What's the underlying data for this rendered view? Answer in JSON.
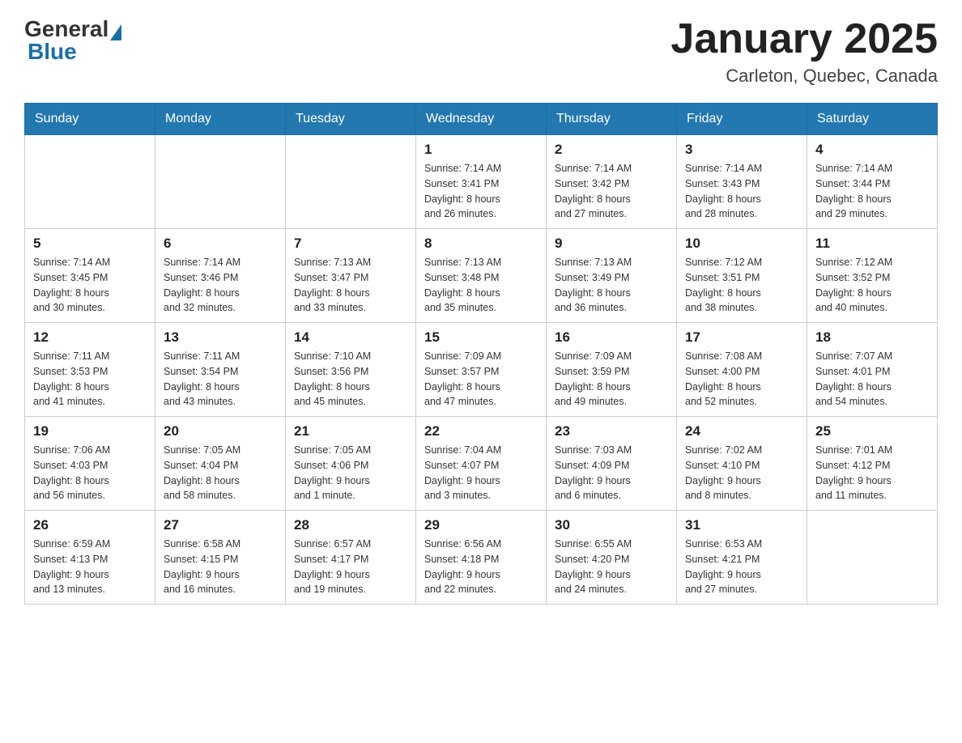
{
  "header": {
    "logo_general": "General",
    "logo_blue": "Blue",
    "month_title": "January 2025",
    "location": "Carleton, Quebec, Canada"
  },
  "days_of_week": [
    "Sunday",
    "Monday",
    "Tuesday",
    "Wednesday",
    "Thursday",
    "Friday",
    "Saturday"
  ],
  "weeks": [
    [
      {
        "day": "",
        "info": ""
      },
      {
        "day": "",
        "info": ""
      },
      {
        "day": "",
        "info": ""
      },
      {
        "day": "1",
        "info": "Sunrise: 7:14 AM\nSunset: 3:41 PM\nDaylight: 8 hours\nand 26 minutes."
      },
      {
        "day": "2",
        "info": "Sunrise: 7:14 AM\nSunset: 3:42 PM\nDaylight: 8 hours\nand 27 minutes."
      },
      {
        "day": "3",
        "info": "Sunrise: 7:14 AM\nSunset: 3:43 PM\nDaylight: 8 hours\nand 28 minutes."
      },
      {
        "day": "4",
        "info": "Sunrise: 7:14 AM\nSunset: 3:44 PM\nDaylight: 8 hours\nand 29 minutes."
      }
    ],
    [
      {
        "day": "5",
        "info": "Sunrise: 7:14 AM\nSunset: 3:45 PM\nDaylight: 8 hours\nand 30 minutes."
      },
      {
        "day": "6",
        "info": "Sunrise: 7:14 AM\nSunset: 3:46 PM\nDaylight: 8 hours\nand 32 minutes."
      },
      {
        "day": "7",
        "info": "Sunrise: 7:13 AM\nSunset: 3:47 PM\nDaylight: 8 hours\nand 33 minutes."
      },
      {
        "day": "8",
        "info": "Sunrise: 7:13 AM\nSunset: 3:48 PM\nDaylight: 8 hours\nand 35 minutes."
      },
      {
        "day": "9",
        "info": "Sunrise: 7:13 AM\nSunset: 3:49 PM\nDaylight: 8 hours\nand 36 minutes."
      },
      {
        "day": "10",
        "info": "Sunrise: 7:12 AM\nSunset: 3:51 PM\nDaylight: 8 hours\nand 38 minutes."
      },
      {
        "day": "11",
        "info": "Sunrise: 7:12 AM\nSunset: 3:52 PM\nDaylight: 8 hours\nand 40 minutes."
      }
    ],
    [
      {
        "day": "12",
        "info": "Sunrise: 7:11 AM\nSunset: 3:53 PM\nDaylight: 8 hours\nand 41 minutes."
      },
      {
        "day": "13",
        "info": "Sunrise: 7:11 AM\nSunset: 3:54 PM\nDaylight: 8 hours\nand 43 minutes."
      },
      {
        "day": "14",
        "info": "Sunrise: 7:10 AM\nSunset: 3:56 PM\nDaylight: 8 hours\nand 45 minutes."
      },
      {
        "day": "15",
        "info": "Sunrise: 7:09 AM\nSunset: 3:57 PM\nDaylight: 8 hours\nand 47 minutes."
      },
      {
        "day": "16",
        "info": "Sunrise: 7:09 AM\nSunset: 3:59 PM\nDaylight: 8 hours\nand 49 minutes."
      },
      {
        "day": "17",
        "info": "Sunrise: 7:08 AM\nSunset: 4:00 PM\nDaylight: 8 hours\nand 52 minutes."
      },
      {
        "day": "18",
        "info": "Sunrise: 7:07 AM\nSunset: 4:01 PM\nDaylight: 8 hours\nand 54 minutes."
      }
    ],
    [
      {
        "day": "19",
        "info": "Sunrise: 7:06 AM\nSunset: 4:03 PM\nDaylight: 8 hours\nand 56 minutes."
      },
      {
        "day": "20",
        "info": "Sunrise: 7:05 AM\nSunset: 4:04 PM\nDaylight: 8 hours\nand 58 minutes."
      },
      {
        "day": "21",
        "info": "Sunrise: 7:05 AM\nSunset: 4:06 PM\nDaylight: 9 hours\nand 1 minute."
      },
      {
        "day": "22",
        "info": "Sunrise: 7:04 AM\nSunset: 4:07 PM\nDaylight: 9 hours\nand 3 minutes."
      },
      {
        "day": "23",
        "info": "Sunrise: 7:03 AM\nSunset: 4:09 PM\nDaylight: 9 hours\nand 6 minutes."
      },
      {
        "day": "24",
        "info": "Sunrise: 7:02 AM\nSunset: 4:10 PM\nDaylight: 9 hours\nand 8 minutes."
      },
      {
        "day": "25",
        "info": "Sunrise: 7:01 AM\nSunset: 4:12 PM\nDaylight: 9 hours\nand 11 minutes."
      }
    ],
    [
      {
        "day": "26",
        "info": "Sunrise: 6:59 AM\nSunset: 4:13 PM\nDaylight: 9 hours\nand 13 minutes."
      },
      {
        "day": "27",
        "info": "Sunrise: 6:58 AM\nSunset: 4:15 PM\nDaylight: 9 hours\nand 16 minutes."
      },
      {
        "day": "28",
        "info": "Sunrise: 6:57 AM\nSunset: 4:17 PM\nDaylight: 9 hours\nand 19 minutes."
      },
      {
        "day": "29",
        "info": "Sunrise: 6:56 AM\nSunset: 4:18 PM\nDaylight: 9 hours\nand 22 minutes."
      },
      {
        "day": "30",
        "info": "Sunrise: 6:55 AM\nSunset: 4:20 PM\nDaylight: 9 hours\nand 24 minutes."
      },
      {
        "day": "31",
        "info": "Sunrise: 6:53 AM\nSunset: 4:21 PM\nDaylight: 9 hours\nand 27 minutes."
      },
      {
        "day": "",
        "info": ""
      }
    ]
  ]
}
